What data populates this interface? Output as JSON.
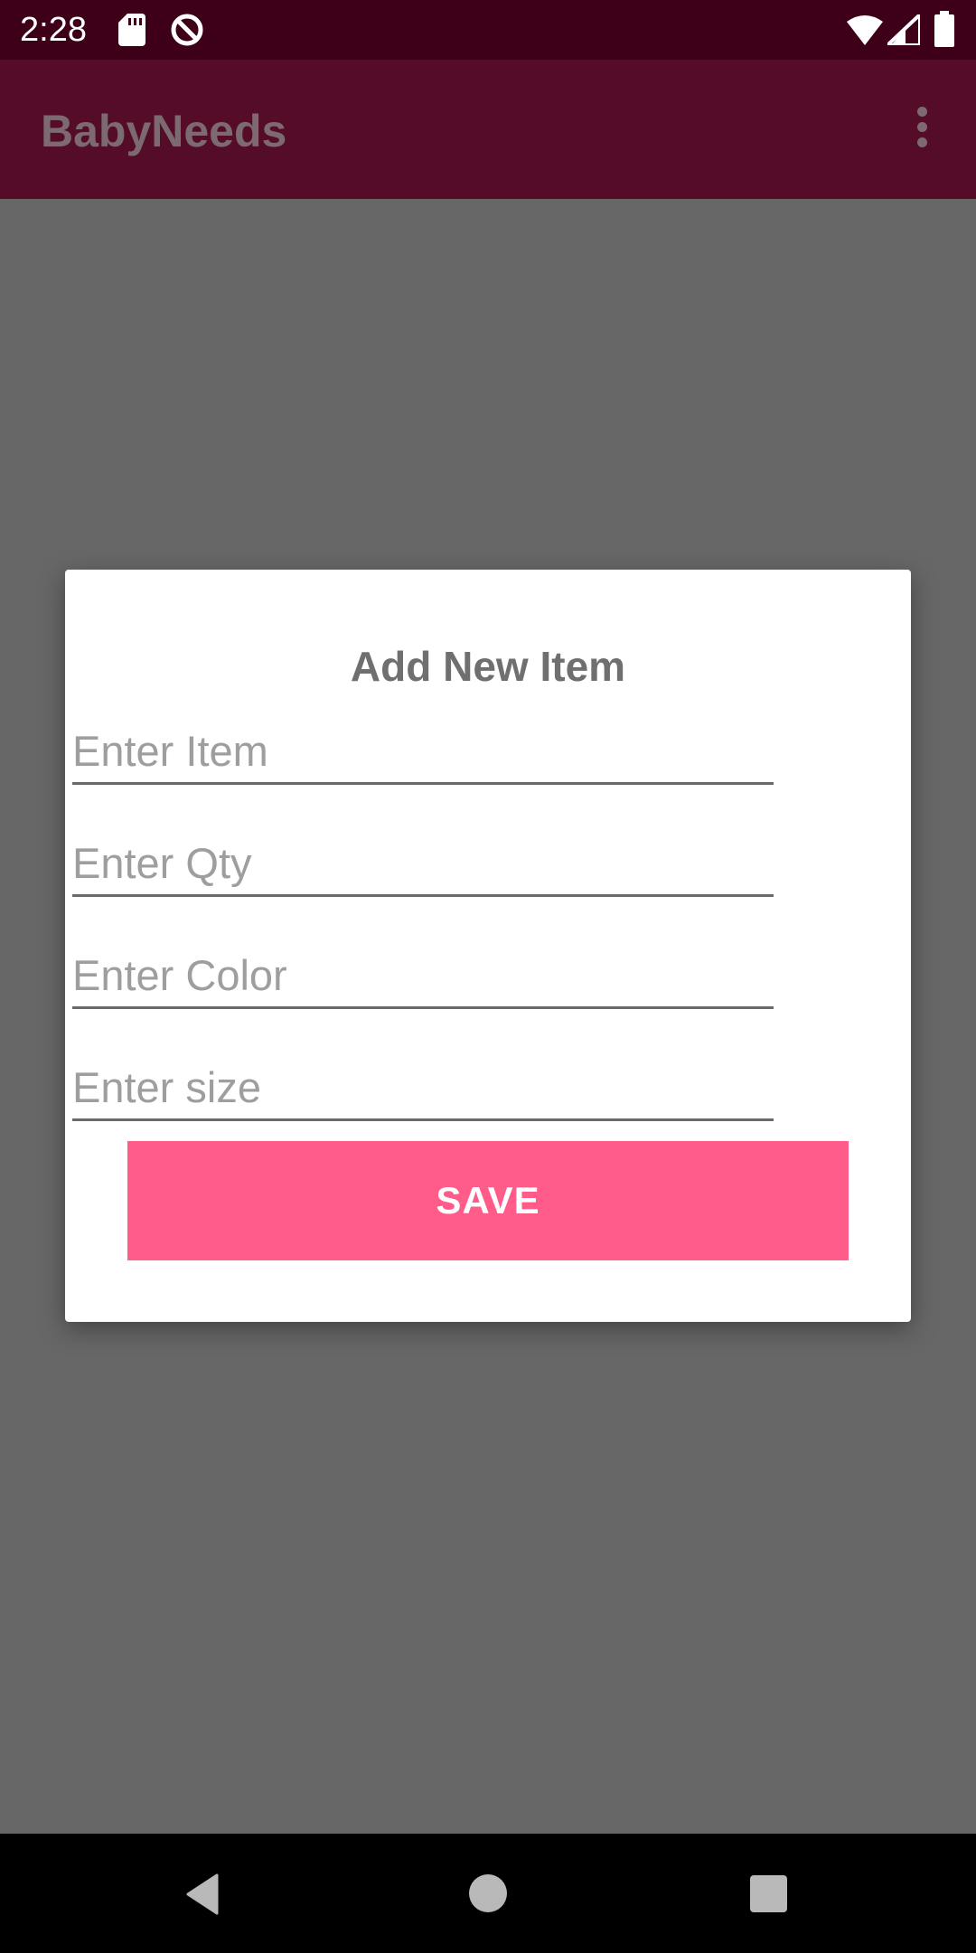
{
  "status_bar": {
    "time": "2:28",
    "icons": [
      "sd-card-icon",
      "sync-icon",
      "wifi-icon",
      "signal-icon",
      "battery-icon"
    ]
  },
  "app_bar": {
    "title": "BabyNeeds",
    "menu_icon": "overflow-menu-icon"
  },
  "dialog": {
    "title": "Add New Item",
    "fields": {
      "item": {
        "value": "",
        "placeholder": "Enter Item"
      },
      "qty": {
        "value": "",
        "placeholder": "Enter Qty"
      },
      "color": {
        "value": "",
        "placeholder": "Enter Color"
      },
      "size": {
        "value": "",
        "placeholder": "Enter size"
      }
    },
    "save_label": "SAVE"
  },
  "nav_bar": {
    "icons": [
      "back-icon",
      "home-icon",
      "recents-icon"
    ]
  },
  "colors": {
    "status_bar": "#3e0019",
    "app_bar": "#550c29",
    "scrim": "#676767",
    "accent": "#ff5c8a"
  }
}
